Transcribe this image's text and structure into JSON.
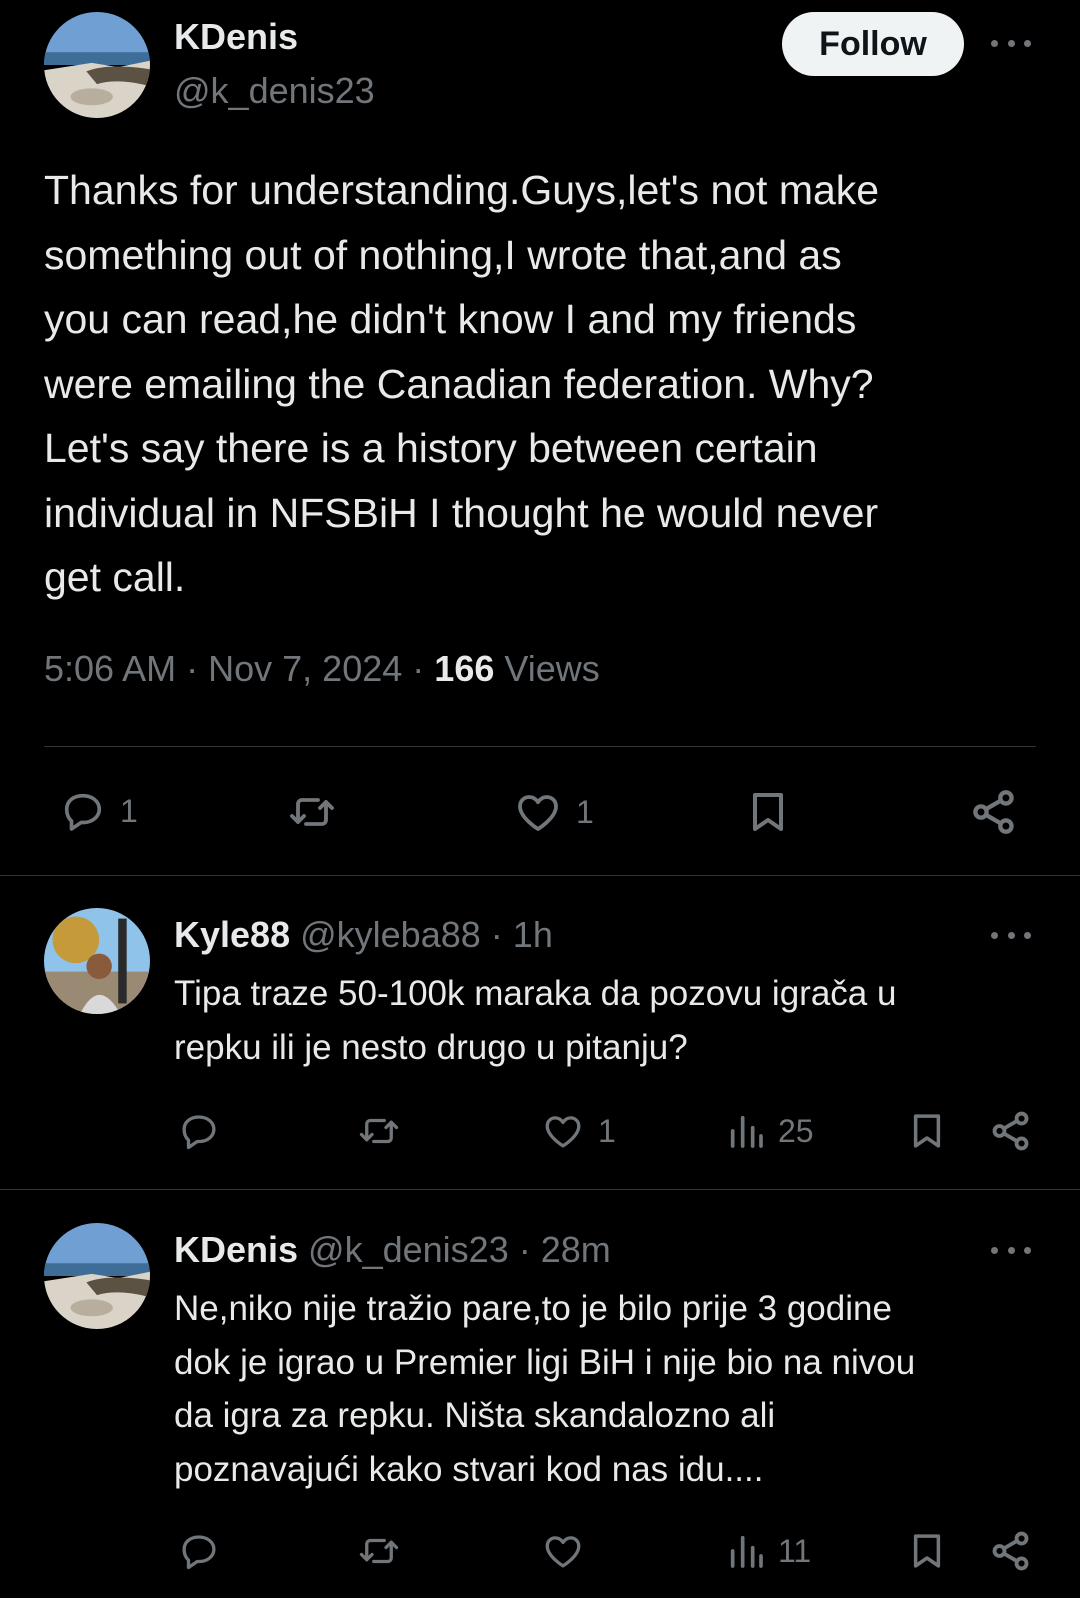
{
  "main_tweet": {
    "author_name": "KDenis",
    "author_handle": "@k_denis23",
    "follow_label": "Follow",
    "text": "Thanks for understanding.Guys,let's not make\nsomething out of nothing,I wrote that,and as\nyou can read,he didn't know I and my friends\nwere emailing the Canadian federation. Why?\nLet's say there is a history between certain\nindividual in NFSBiH I thought he would never\nget call.",
    "time": "5:06 AM",
    "date": "Nov 7, 2024",
    "views_count": "166",
    "views_label": "Views",
    "replies": "1",
    "likes": "1"
  },
  "replies": [
    {
      "author_name": "Kyle88",
      "author_handle": "@kyleba88",
      "time": "1h",
      "text": "Tipa traze 50-100k maraka da pozovu igrača u\nrepku ili je nesto drugo u pitanju?",
      "likes": "1",
      "views": "25"
    },
    {
      "author_name": "KDenis",
      "author_handle": "@k_denis23",
      "time": "28m",
      "text": "Ne,niko nije tražio pare,to je bilo prije 3 godine\ndok je igrao u Premier ligi BiH i nije bio na nivou\nda igra za repku. Ništa skandalozno ali\npoznavajući kako stvari kod nas idu....",
      "likes": "",
      "views": "11"
    }
  ],
  "colors": {
    "background": "#000000",
    "text": "#e7e9ea",
    "muted": "#71767b",
    "divider": "#2f3336",
    "follow_bg": "#eff3f4"
  },
  "icons": [
    "reply-icon",
    "repost-icon",
    "like-icon",
    "views-icon",
    "bookmark-icon",
    "share-icon",
    "more-icon"
  ]
}
